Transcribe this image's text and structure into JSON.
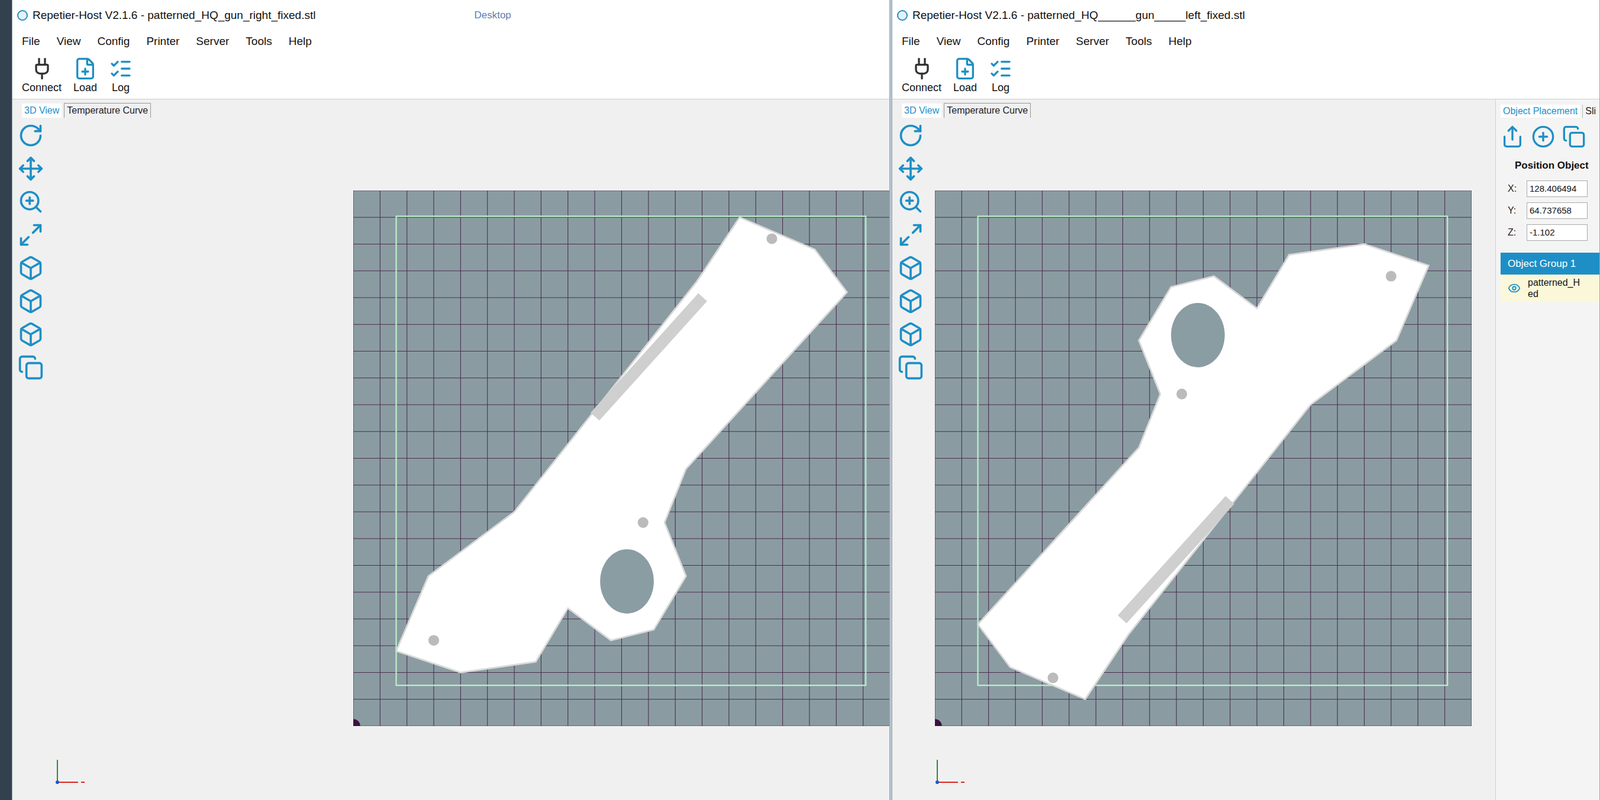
{
  "desktop": {
    "background_text": "Desktop"
  },
  "windows": [
    {
      "title": "Repetier-Host V2.1.6 - patterned_HQ_gun_right_fixed.stl",
      "menu": [
        "File",
        "View",
        "Config",
        "Printer",
        "Server",
        "Tools",
        "Help"
      ],
      "toolbar": [
        {
          "label": "Connect"
        },
        {
          "label": "Load"
        },
        {
          "label": "Log"
        }
      ],
      "view_tabs": [
        {
          "label": "3D View",
          "selected": true
        },
        {
          "label": "Temperature Curve",
          "selected": false
        }
      ],
      "model": {
        "orientation": "right"
      },
      "side_panel": null
    },
    {
      "title": "Repetier-Host V2.1.6 - patterned_HQ______gun_____left_fixed.stl",
      "menu": [
        "File",
        "View",
        "Config",
        "Printer",
        "Server",
        "Tools",
        "Help"
      ],
      "toolbar": [
        {
          "label": "Connect"
        },
        {
          "label": "Load"
        },
        {
          "label": "Log"
        }
      ],
      "view_tabs": [
        {
          "label": "3D View",
          "selected": true
        },
        {
          "label": "Temperature Curve",
          "selected": false
        }
      ],
      "model": {
        "orientation": "left"
      },
      "side_panel": {
        "tabs": [
          {
            "label": "Object Placement",
            "selected": true
          },
          {
            "label": "Sli",
            "selected": false
          }
        ],
        "heading": "Position Object",
        "fields": [
          {
            "label": "X:",
            "value": "128.406494"
          },
          {
            "label": "Y:",
            "value": "64.737658"
          },
          {
            "label": "Z:",
            "value": "-1.102"
          }
        ],
        "group": {
          "label": "Object Group 1",
          "items": [
            {
              "name_lines": [
                "patterned_H",
                "ed"
              ],
              "visible": true
            }
          ]
        }
      }
    }
  ]
}
